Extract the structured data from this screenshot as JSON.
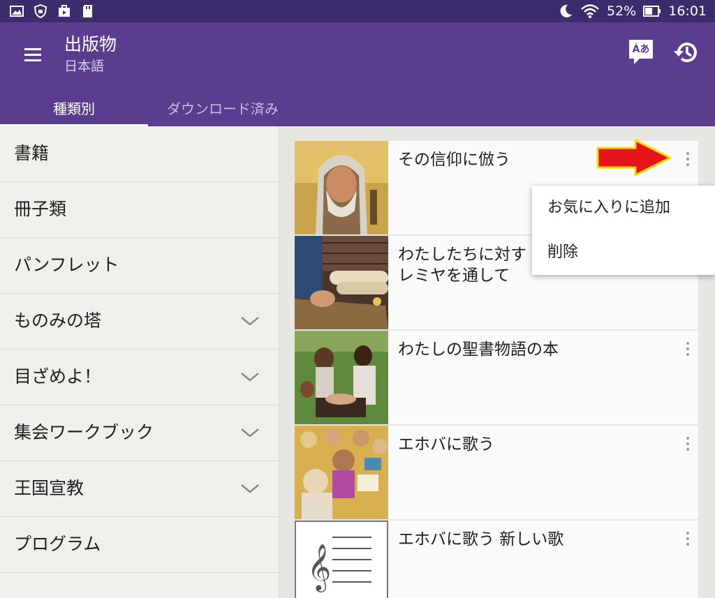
{
  "status_bar": {
    "battery_percent": "52%",
    "time": "16:01",
    "left_icons": [
      "gallery-icon",
      "shield-icon",
      "briefcase-icon",
      "sd-card-icon"
    ],
    "right_icons": [
      "moon-icon",
      "wifi-icon",
      "battery-icon"
    ]
  },
  "app_bar": {
    "title": "出版物",
    "subtitle": "日本語",
    "lang_button_label": "Áあ",
    "tabs": [
      {
        "label": "種類別",
        "selected": true
      },
      {
        "label": "ダウンロード済み",
        "selected": false
      }
    ]
  },
  "categories": [
    {
      "label": "書籍",
      "expandable": false
    },
    {
      "label": "冊子類",
      "expandable": false
    },
    {
      "label": "パンフレット",
      "expandable": false
    },
    {
      "label": "ものみの塔",
      "expandable": true
    },
    {
      "label": "目ざめよ！",
      "expandable": true
    },
    {
      "label": "集会ワークブック",
      "expandable": true
    },
    {
      "label": "王国宣教",
      "expandable": true
    },
    {
      "label": "プログラム",
      "expandable": false
    }
  ],
  "publications": [
    {
      "title": "その信仰に倣う"
    },
    {
      "title": "わたしたちに対す",
      "title_line2": "レミヤを通して"
    },
    {
      "title": "わたしの聖書物語の本"
    },
    {
      "title": "エホバに歌う"
    },
    {
      "title": "エホバに歌う 新しい歌"
    }
  ],
  "popup_menu": {
    "items": [
      "お気に入りに追加",
      "削除"
    ]
  },
  "colors": {
    "status_bar": "#3c2c6b",
    "app_bar": "#5b3d8f",
    "sidebar": "#efefeb",
    "annotation_arrow": "#e8141b",
    "annotation_arrow_outline": "#f5d90a"
  }
}
